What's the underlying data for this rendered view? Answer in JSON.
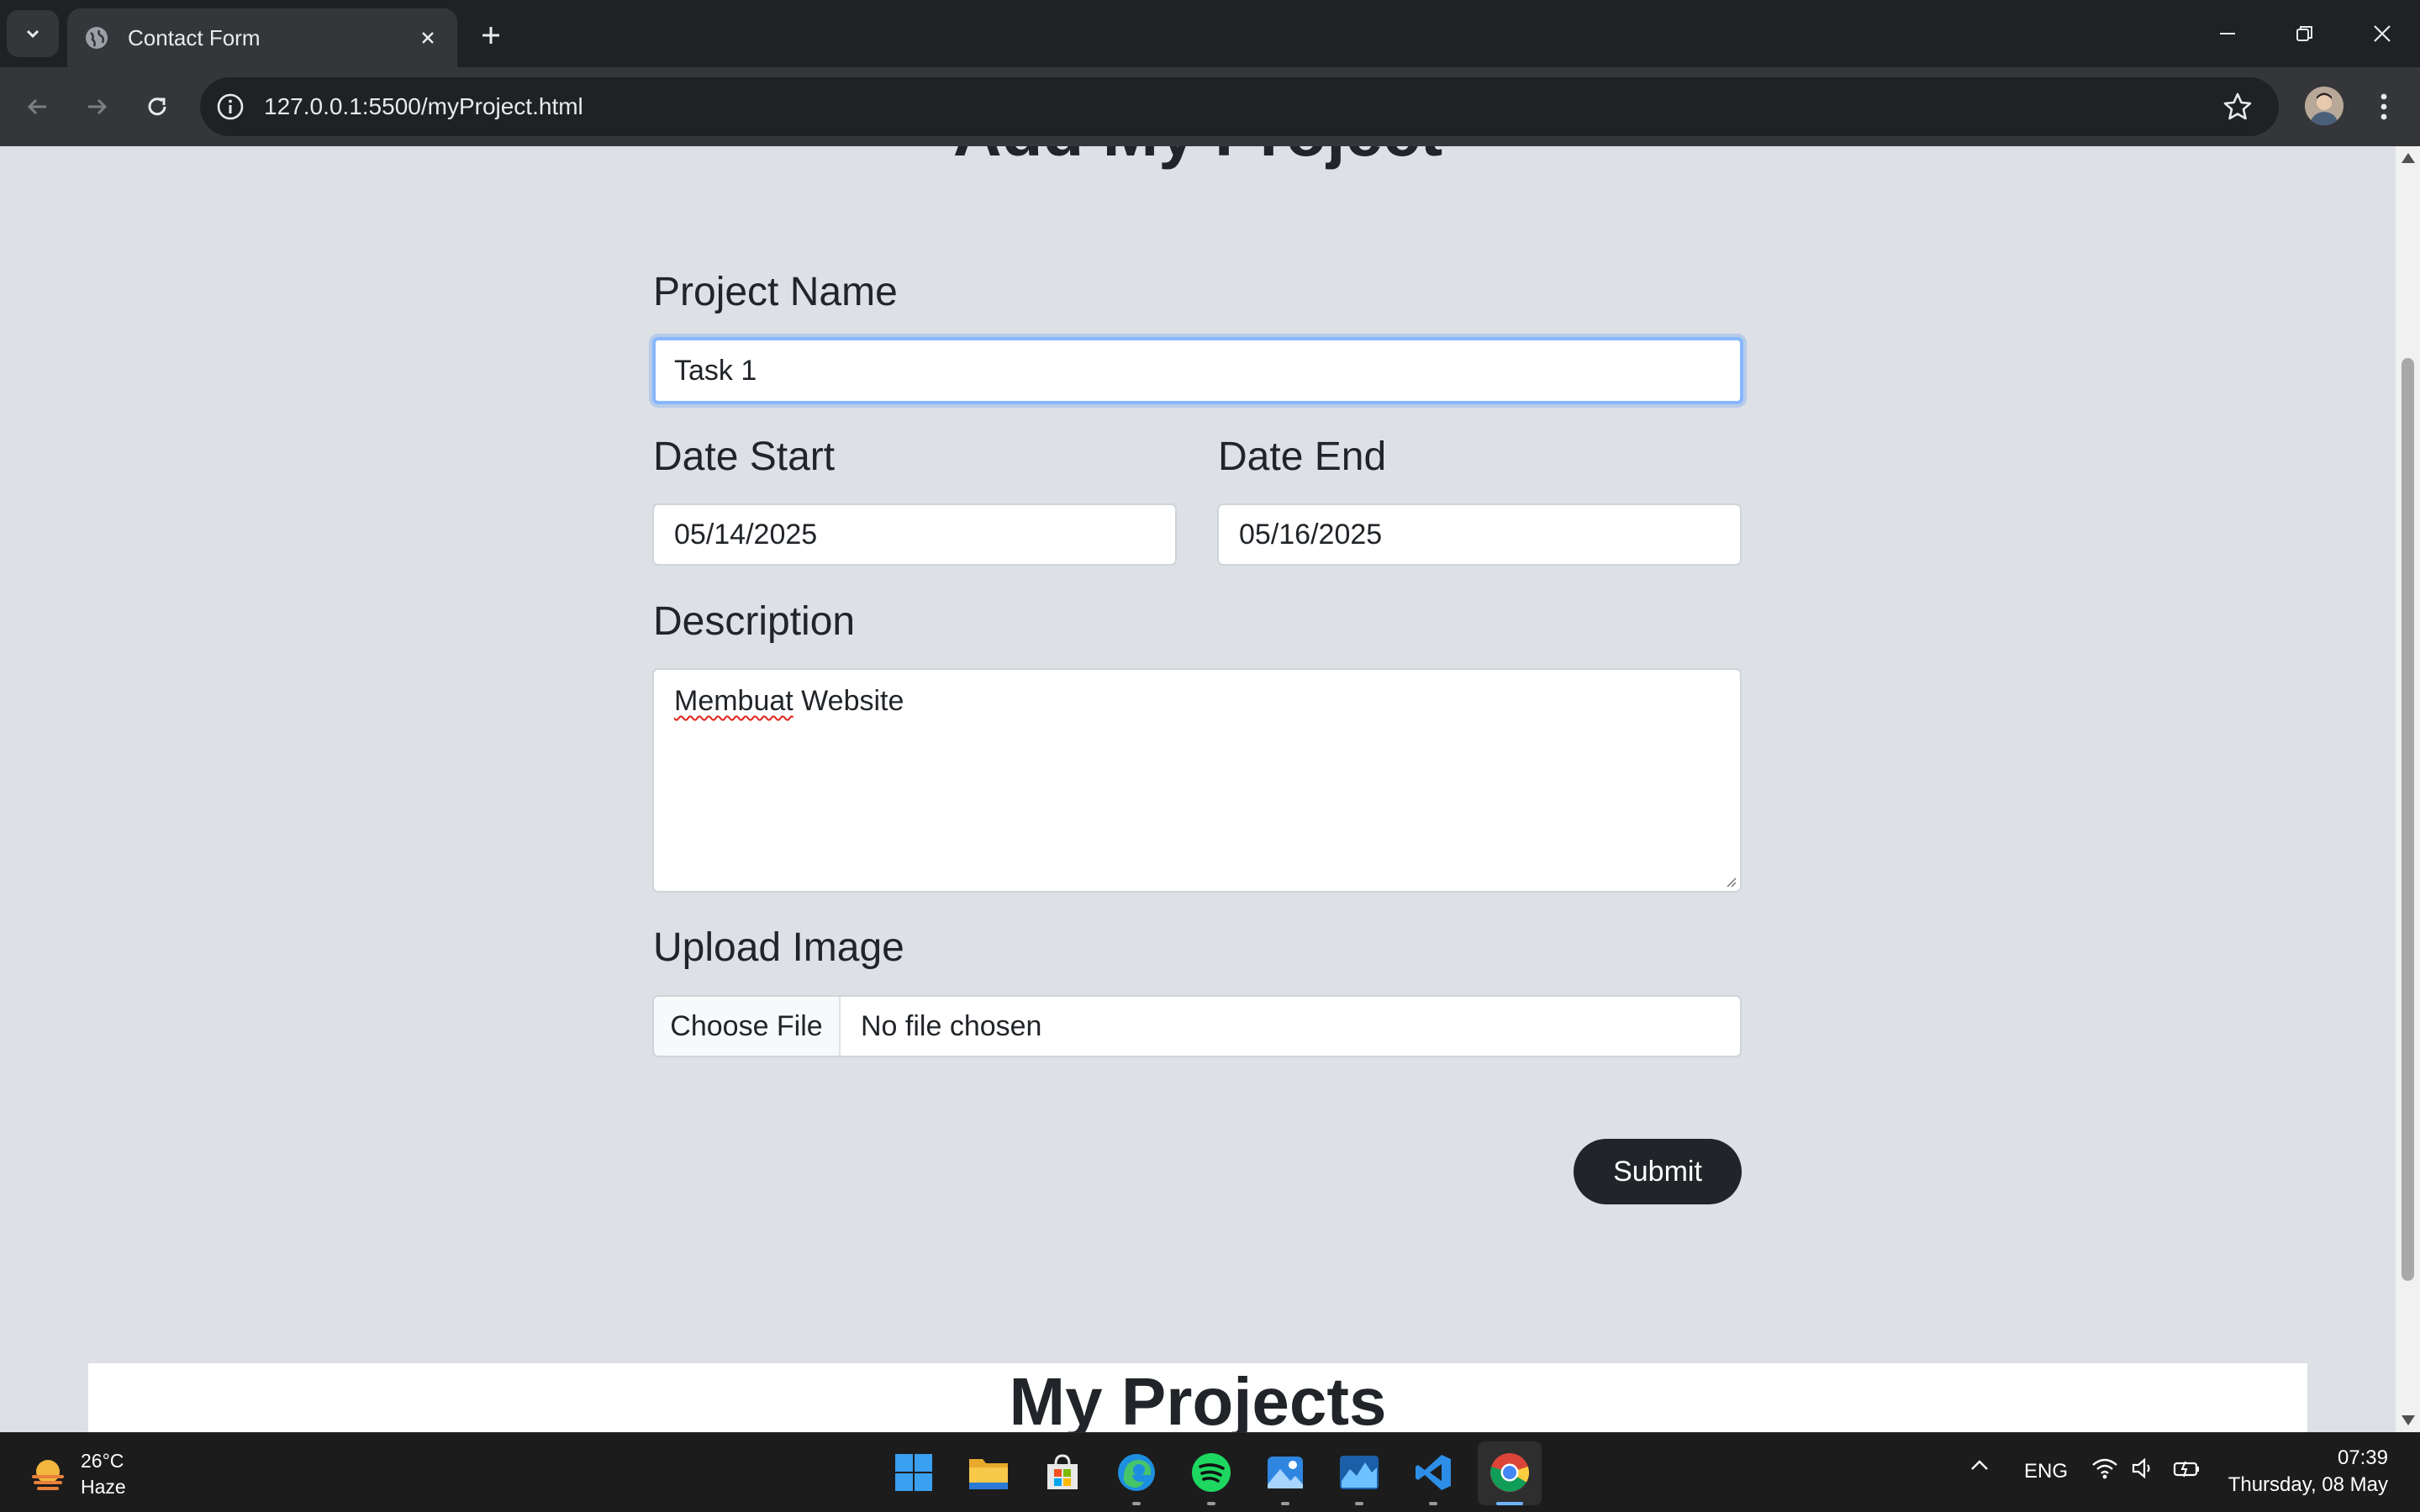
{
  "browser": {
    "tab_title": "Contact Form",
    "url": "127.0.0.1:5500/myProject.html"
  },
  "page": {
    "heading": "Add My Project",
    "form": {
      "project_name_label": "Project Name",
      "project_name_value": "Task 1",
      "date_start_label": "Date Start",
      "date_start_value": "05/14/2025",
      "date_end_label": "Date End",
      "date_end_value": "05/16/2025",
      "description_label": "Description",
      "description_word1": "Membuat",
      "description_word2": " Website",
      "upload_label": "Upload Image",
      "choose_file_label": "Choose File",
      "file_status": "No file chosen",
      "submit_label": "Submit"
    },
    "projects_heading": "My Projects"
  },
  "taskbar": {
    "weather_temp": "26°C",
    "weather_desc": "Haze",
    "language": "ENG",
    "time": "07:39",
    "date": "Thursday, 08 May"
  },
  "colors": {
    "page_bg": "#dde0e5",
    "button_dark": "#212529",
    "focus_ring": "#86b7fe"
  }
}
